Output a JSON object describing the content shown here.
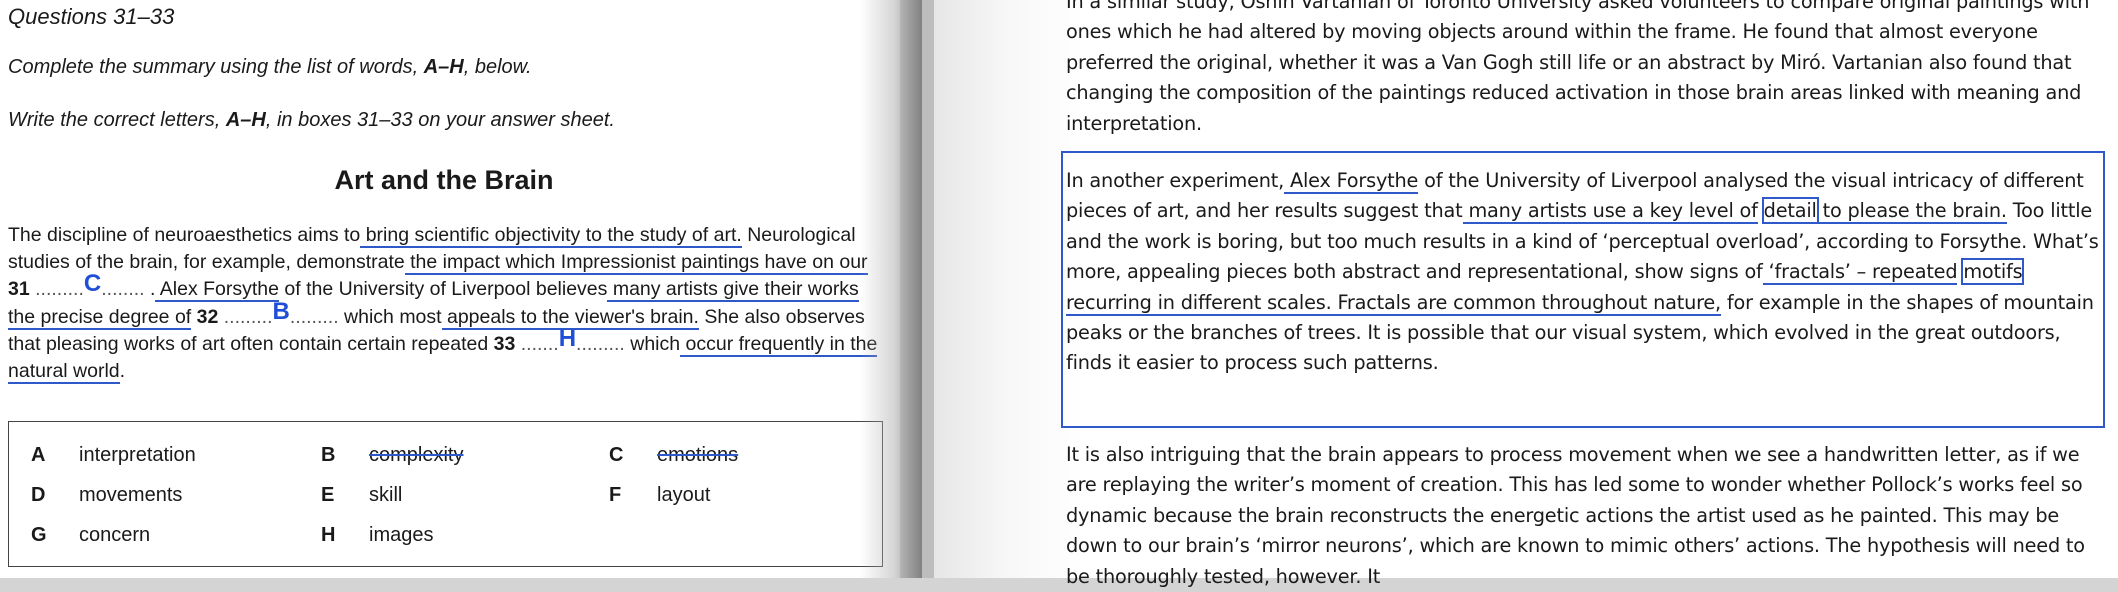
{
  "questions": {
    "heading": "Questions 31–33",
    "instruction1_pre": "Complete the summary using the list of words, ",
    "instruction1_bold": "A–H",
    "instruction1_post": ", below.",
    "instruction2_pre": "Write the correct letters, ",
    "instruction2_bold": "A–H",
    "instruction2_post": ", in boxes 31–33 on your answer sheet."
  },
  "summary": {
    "title": "Art and the Brain",
    "s1": "The discipline of neuroaesthetics aims to",
    "s1_u": " bring scientific objectivity to the study of art.",
    "s2": " Neurological studies of the brain, for example, demonstrate",
    "s2_u": " the impact which Impressionist paintings have on our",
    "q31": "31",
    "blank31": ".........",
    "answer31": "C",
    "blank31b": "........",
    "s3_pre": " .",
    "s3_u": " Alex Forsythe",
    "s3": " of the University of Liverpool believes",
    "s3b_u": " many artists give their works the precise degree of",
    "q32": "32",
    "blank32": ".........",
    "answer32": "B",
    "blank32b": ".........",
    "s4": " which most",
    "s4_u": " appeals to the viewer's brain.",
    "s5": " She also observes that pleasing works of art often contain certain repeated",
    "q33": "33",
    "blank33": ".......",
    "answer33": "H",
    "blank33b": ".........",
    "s6": " which",
    "s6_u": " occur frequently in the natural world",
    "s6_end": "."
  },
  "options": [
    {
      "letter": "A",
      "word": "interpretation"
    },
    {
      "letter": "B",
      "word": "complexity"
    },
    {
      "letter": "C",
      "word": "emotions"
    },
    {
      "letter": "D",
      "word": "movements"
    },
    {
      "letter": "E",
      "word": "skill"
    },
    {
      "letter": "F",
      "word": "layout"
    },
    {
      "letter": "G",
      "word": "concern"
    },
    {
      "letter": "H",
      "word": "images"
    }
  ],
  "passage": {
    "p1_l0": "In a similar study, Oshin Vartanian of Toronto University asked volunteers to compare original",
    "p1_rest": "paintings with ones which he had altered by moving objects around within the frame. He found that almost everyone preferred the original, whether it was a Van Gogh still life or an abstract by Miró. Vartanian also found that changing the composition of the paintings reduced activation in those brain areas linked with meaning and interpretation.",
    "p2_a": "In another experiment,",
    "p2_a_u": " Alex Forsythe",
    "p2_b": " of the University of Liverpool analysed the visual intricacy of different pieces of art, and her results suggest that",
    "p2_b_u": " many artists use a key level of",
    "p2_detail": "detail",
    "p2_c_u": " to please the brain.",
    "p2_d": " Too little and the work is boring, but too much results in a kind of ‘perceptual overload’, according to Forsythe. What’s more, appealing pieces both abstract and representational, show signs of",
    "p2_e_u": " ‘fractals’ – repeated",
    "p2_motifs": "motifs",
    "p2_f_u": " recurring in different scales. Fractals are common throughout nature,",
    "p2_g": " for example in the shapes of mountain peaks or the branches of trees. It is possible that our visual system, which evolved in the great outdoors, finds it easier to process such patterns.",
    "p3": "It is also intriguing that the brain appears to process movement when we see a handwritten letter, as if we are replaying the writer’s moment of creation. This has led some to wonder whether Pollock’s works feel so dynamic because the brain reconstructs the energetic actions the artist used as he painted. This may be down to our brain’s ‘mirror neurons’, which are known to mimic others’ actions. The hypothesis will need to be thoroughly tested, however. It"
  }
}
